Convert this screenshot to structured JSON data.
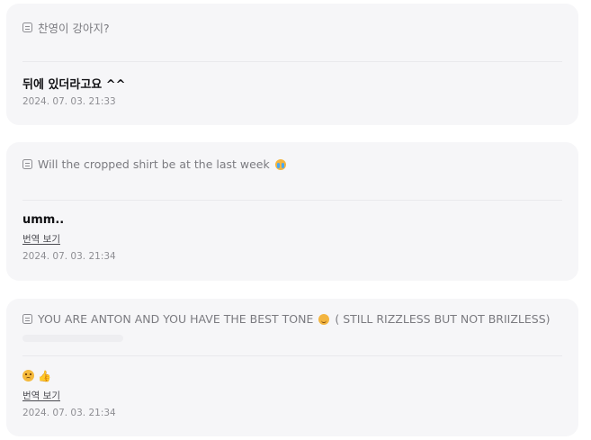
{
  "cards": [
    {
      "question": "찬영이 강아지?",
      "answer": "뒤에 있더라고요 ^^",
      "timestamp": "2024. 07. 03. 21:33"
    },
    {
      "question": "Will the cropped shirt be at the last week",
      "question_emoji": "crying-face-emoji",
      "answer": "umm..",
      "translate_label": "번역 보기",
      "timestamp": "2024. 07. 03. 21:34"
    },
    {
      "question": "YOU ARE ANTON AND YOU HAVE THE BEST TONE",
      "question_emoji": "smiling-face-emoji",
      "question_suffix": "( STILL RIZZLESS BUT NOT BRIIZLESS)",
      "answer_emojis": [
        "pensive-face-emoji",
        "thumbs-up-emoji"
      ],
      "translate_label": "번역 보기",
      "timestamp": "2024. 07. 03. 21:34"
    }
  ]
}
